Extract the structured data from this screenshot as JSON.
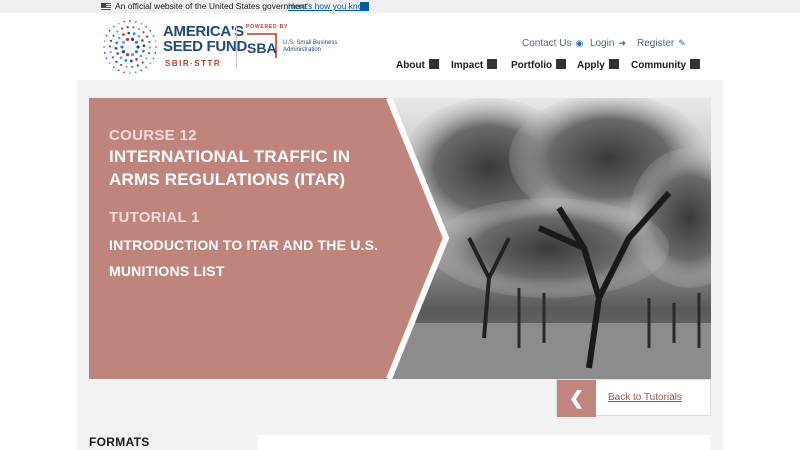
{
  "gov_banner": {
    "text": "An official website of the United States government",
    "link": "Here's how you know",
    "flag_icon": "us-flag-icon"
  },
  "header": {
    "logo": {
      "title_line1": "AMERICA'S",
      "title_line2": "SEED FUND",
      "subtitle": "SBIR·STTR",
      "powered_by": "POWERED BY",
      "sba_mark": "SBA",
      "sba_name": "U.S. Small Business Administration"
    },
    "utility_nav": [
      {
        "label": "Contact Us",
        "icon": "chat-bubble-icon"
      },
      {
        "label": "Login",
        "icon": "sign-in-icon"
      },
      {
        "label": "Register",
        "icon": "pencil-icon"
      }
    ],
    "main_nav": [
      "About",
      "Impact",
      "Portfolio",
      "Apply",
      "Community"
    ]
  },
  "hero": {
    "course_label": "COURSE 12",
    "course_title": "INTERNATIONAL TRAFFIC IN ARMS REGULATIONS (ITAR)",
    "tutorial_label": "TUTORIAL 1",
    "tutorial_title": "INTRODUCTION TO ITAR AND THE U.S. MUNITIONS LIST"
  },
  "back_button": {
    "label": "Back to Tutorials",
    "icon": "chevron-left-icon"
  },
  "sidebar": {
    "formats_heading": "FORMATS"
  },
  "colors": {
    "hero_panel": "#bf857d",
    "brand_blue": "#1e4a7a",
    "brand_red": "#c0392b",
    "link_blue": "#005ea2",
    "page_background": "#f2f2f2"
  }
}
